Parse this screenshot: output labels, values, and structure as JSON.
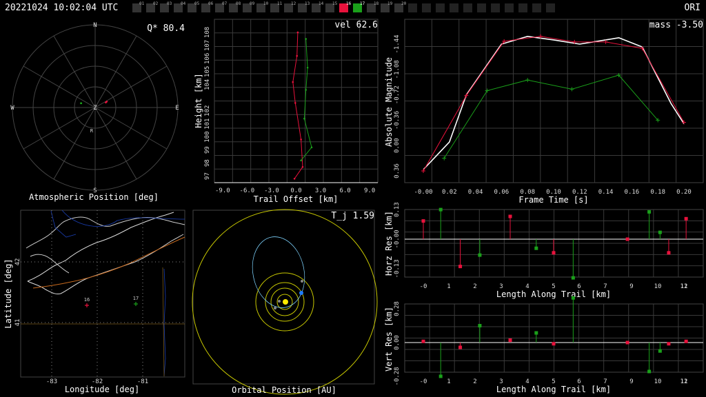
{
  "header": {
    "timestamp": "20221024 10:02:04 UTC",
    "station": "ORI",
    "cameras": [
      {
        "id": "01",
        "state": "off"
      },
      {
        "id": "02",
        "state": "off"
      },
      {
        "id": "03",
        "state": "off"
      },
      {
        "id": "04",
        "state": "off"
      },
      {
        "id": "05",
        "state": "off"
      },
      {
        "id": "06",
        "state": "off"
      },
      {
        "id": "07",
        "state": "off"
      },
      {
        "id": "08",
        "state": "off"
      },
      {
        "id": "09",
        "state": "off"
      },
      {
        "id": "10",
        "state": "off"
      },
      {
        "id": "11",
        "state": "off"
      },
      {
        "id": "12",
        "state": "off"
      },
      {
        "id": "13",
        "state": "off"
      },
      {
        "id": "14",
        "state": "off"
      },
      {
        "id": "15",
        "state": "off"
      },
      {
        "id": "16",
        "state": "red"
      },
      {
        "id": "17",
        "state": "green"
      },
      {
        "id": "18",
        "state": "off"
      },
      {
        "id": "19",
        "state": "off"
      },
      {
        "id": "20",
        "state": "off"
      },
      {
        "id": "",
        "state": "empty"
      },
      {
        "id": "",
        "state": "empty"
      },
      {
        "id": "",
        "state": "empty"
      },
      {
        "id": "",
        "state": "empty"
      },
      {
        "id": "",
        "state": "empty"
      },
      {
        "id": "",
        "state": "empty"
      },
      {
        "id": "",
        "state": "empty"
      },
      {
        "id": "",
        "state": "empty"
      },
      {
        "id": "",
        "state": "empty"
      },
      {
        "id": "",
        "state": "empty"
      },
      {
        "id": "",
        "state": "empty"
      }
    ]
  },
  "colors": {
    "red": "#e8123c",
    "green": "#1aa01a",
    "white": "#ffffff",
    "grid": "#3a3a3a",
    "yellow": "#d8d800",
    "cyan": "#7fd4ff"
  },
  "polar": {
    "title": "Atmospheric Position [deg]",
    "quality": "Q* 80.4",
    "dirs": {
      "n": "N",
      "s": "S",
      "e": "E",
      "w": "W",
      "z": "Z",
      "r": "R"
    },
    "tracks": [
      {
        "color": "red",
        "points": [
          [
            75,
            62
          ],
          [
            78,
            66
          ]
        ]
      },
      {
        "color": "green",
        "points": [
          [
            75,
            -72
          ],
          [
            73,
            -74
          ]
        ]
      }
    ]
  },
  "trail": {
    "title": "Trail Offset [km]",
    "ylabel": "Height [km]",
    "vel": "vel 62.6",
    "xticks": [
      "-9.0",
      "-6.0",
      "-3.0",
      "0.0",
      "3.0",
      "6.0",
      "9.0"
    ],
    "yticks": [
      "97",
      "98",
      "99",
      "100",
      "101",
      "102",
      "104",
      "105",
      "106",
      "107",
      "108"
    ],
    "red": [
      [
        0.2,
        108.0
      ],
      [
        0.1,
        106.2
      ],
      [
        -0.4,
        104.2
      ],
      [
        -0.1,
        102.6
      ],
      [
        0.6,
        99.8
      ],
      [
        0.8,
        97.7
      ],
      [
        -0.2,
        96.8
      ]
    ],
    "green": [
      [
        1.2,
        107.5
      ],
      [
        1.4,
        105.3
      ],
      [
        1.2,
        103.6
      ],
      [
        1.0,
        101.4
      ],
      [
        1.9,
        99.2
      ],
      [
        0.6,
        98.2
      ]
    ]
  },
  "mag": {
    "xlabel": "Frame Time [s]",
    "ylabel": "Absolute Magnitude",
    "mass": "mass -3.50",
    "xticks": [
      "-0.00",
      "0.02",
      "0.04",
      "0.06",
      "0.08",
      "0.10",
      "0.12",
      "0.14",
      "0.16",
      "0.18",
      "0.20"
    ],
    "yticks": [
      "-1.44",
      "-1.08",
      "-0.72",
      "-0.36",
      "0.00",
      "0.36"
    ],
    "white": [
      [
        0.0,
        0.34
      ],
      [
        0.02,
        -0.05
      ],
      [
        0.033,
        -0.72
      ],
      [
        0.06,
        -1.44
      ],
      [
        0.08,
        -1.55
      ],
      [
        0.1,
        -1.5
      ],
      [
        0.12,
        -1.44
      ],
      [
        0.13,
        -1.47
      ],
      [
        0.15,
        -1.53
      ],
      [
        0.168,
        -1.4
      ],
      [
        0.19,
        -0.6
      ],
      [
        0.2,
        -0.31
      ]
    ],
    "red": [
      [
        0.0,
        0.36
      ],
      [
        0.033,
        -0.71
      ],
      [
        0.062,
        -1.48
      ],
      [
        0.09,
        -1.55
      ],
      [
        0.116,
        -1.47
      ],
      [
        0.14,
        -1.47
      ],
      [
        0.168,
        -1.38
      ],
      [
        0.2,
        -0.33
      ]
    ],
    "green": [
      [
        0.016,
        0.18
      ],
      [
        0.049,
        -0.78
      ],
      [
        0.08,
        -0.93
      ],
      [
        0.114,
        -0.8
      ],
      [
        0.15,
        -1.0
      ],
      [
        0.18,
        -0.36
      ]
    ]
  },
  "map": {
    "xlabel": "Longitude [deg]",
    "ylabel": "Latitude [deg]",
    "xticks": [
      "-83",
      "-82",
      "-81"
    ],
    "yticks": [
      "42",
      "41"
    ],
    "markers": [
      {
        "label": "16",
        "color": "red"
      },
      {
        "label": "17",
        "color": "green"
      }
    ]
  },
  "orbit": {
    "title": "Orbital Position [AU]",
    "tj": "T_j 1.59"
  },
  "hres": {
    "xlabel": "Length Along Trail [km]",
    "ylabel": "Horz Res [km]",
    "xticks": [
      "-0",
      "1",
      "2",
      "3",
      "4",
      "5",
      "6",
      "7",
      "9",
      "10",
      "11",
      "12"
    ],
    "yticks": [
      "0.13",
      "-0.00",
      "-0.13"
    ],
    "red": [
      [
        -0.0,
        0.08
      ],
      [
        1.7,
        -0.12
      ],
      [
        4.0,
        0.1
      ],
      [
        6.0,
        -0.06
      ],
      [
        9.4,
        0.0
      ],
      [
        11.3,
        -0.06
      ],
      [
        12.1,
        0.09
      ]
    ],
    "green": [
      [
        0.8,
        0.13
      ],
      [
        2.6,
        -0.07
      ],
      [
        5.2,
        -0.04
      ],
      [
        6.9,
        -0.17
      ],
      [
        10.4,
        0.12
      ],
      [
        10.9,
        0.03
      ]
    ]
  },
  "vres": {
    "xlabel": "Length Along Trail [km]",
    "ylabel": "Vert Res [km]",
    "xticks": [
      "-0",
      "1",
      "2",
      "3",
      "4",
      "5",
      "6",
      "7",
      "9",
      "10",
      "11",
      "12"
    ],
    "yticks": [
      "0.28",
      "0.00",
      "-0.28"
    ],
    "red": [
      [
        -0.0,
        0.01
      ],
      [
        1.7,
        -0.04
      ],
      [
        4.0,
        0.02
      ],
      [
        6.0,
        -0.01
      ],
      [
        9.4,
        0.0
      ],
      [
        11.3,
        -0.01
      ],
      [
        12.1,
        0.01
      ]
    ],
    "green": [
      [
        0.8,
        -0.28
      ],
      [
        2.6,
        0.14
      ],
      [
        5.2,
        0.08
      ],
      [
        6.9,
        0.37
      ],
      [
        10.4,
        -0.24
      ],
      [
        10.9,
        -0.07
      ]
    ]
  }
}
